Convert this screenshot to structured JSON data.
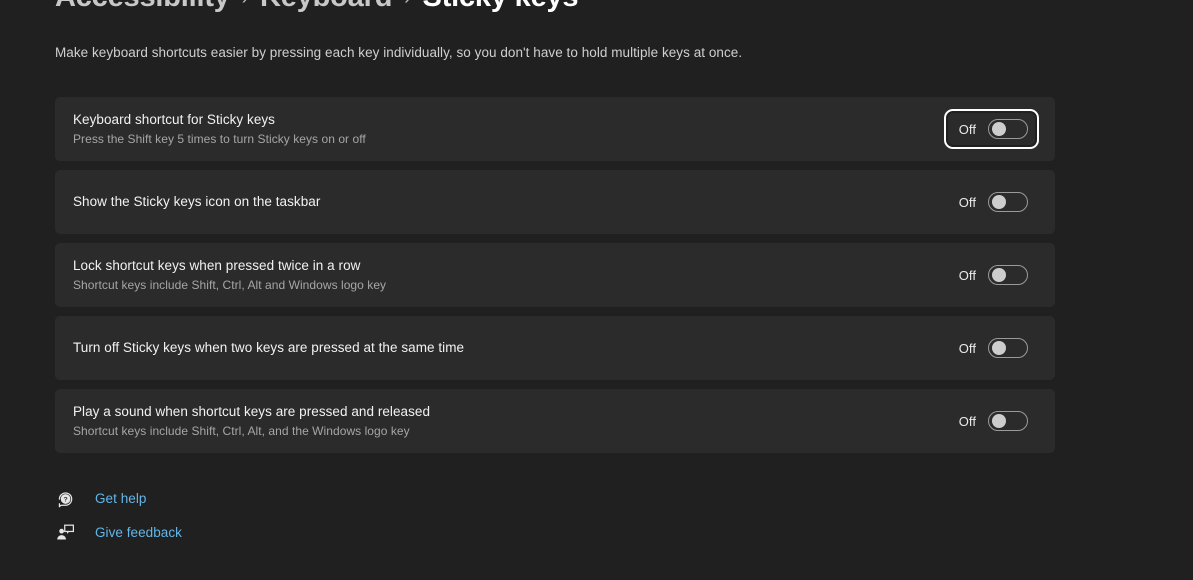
{
  "breadcrumb": {
    "items": [
      {
        "label": "Accessibility",
        "current": false
      },
      {
        "label": "Keyboard",
        "current": false
      },
      {
        "label": "Sticky keys",
        "current": true
      }
    ],
    "separator": "›"
  },
  "page": {
    "description": "Make keyboard shortcuts easier by pressing each key individually, so you don't have to hold multiple keys at once."
  },
  "settings": [
    {
      "title": "Keyboard shortcut for Sticky keys",
      "subtitle": "Press the Shift key 5 times to turn Sticky keys on or off",
      "state": "Off",
      "on": false,
      "focused": true
    },
    {
      "title": "Show the Sticky keys icon on the taskbar",
      "subtitle": "",
      "state": "Off",
      "on": false,
      "focused": false
    },
    {
      "title": "Lock shortcut keys when pressed twice in a row",
      "subtitle": "Shortcut keys include Shift, Ctrl, Alt and Windows logo key",
      "state": "Off",
      "on": false,
      "focused": false
    },
    {
      "title": "Turn off Sticky keys when two keys are pressed at the same time",
      "subtitle": "",
      "state": "Off",
      "on": false,
      "focused": false
    },
    {
      "title": "Play a sound when shortcut keys are pressed and released",
      "subtitle": "Shortcut keys include Shift, Ctrl, Alt, and the Windows logo key",
      "state": "Off",
      "on": false,
      "focused": false
    }
  ],
  "footer": {
    "links": [
      {
        "label": "Get help",
        "icon": "help-question-icon"
      },
      {
        "label": "Give feedback",
        "icon": "feedback-person-icon"
      }
    ]
  },
  "colors": {
    "page_background": "#202020",
    "card_background": "#2b2b2b",
    "accent_link": "#62b6e8",
    "focus_ring": "#ffffff",
    "toggle_knob": "#cdcdcd"
  }
}
